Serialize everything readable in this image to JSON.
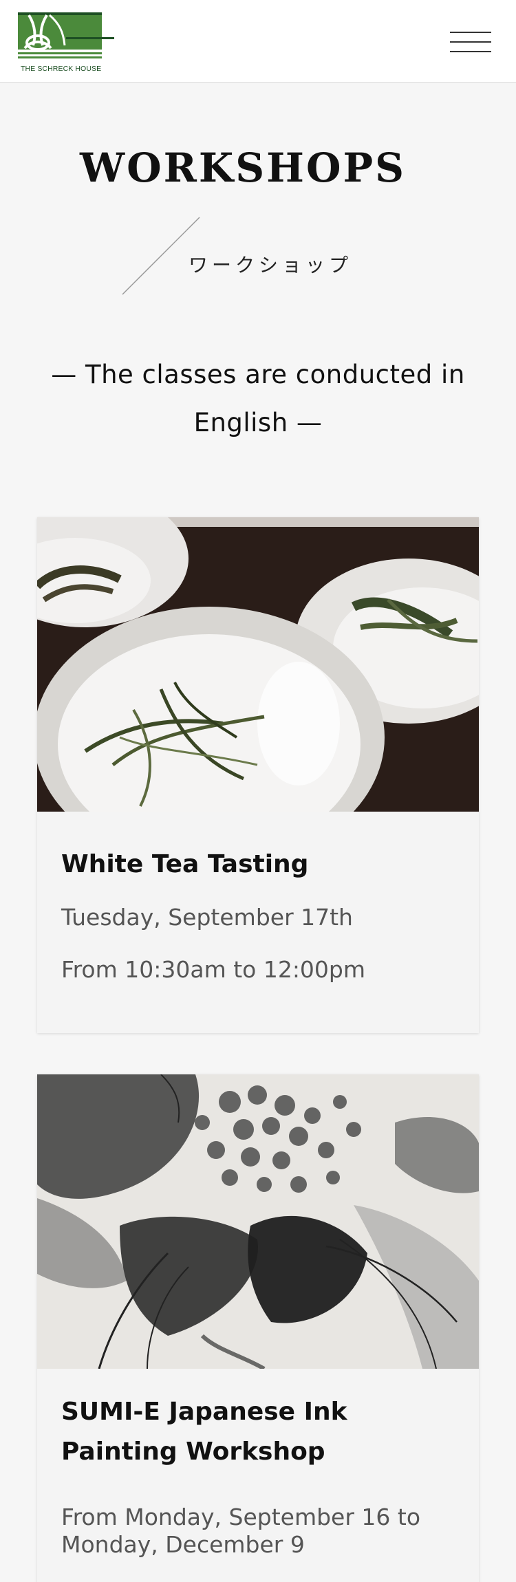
{
  "header": {
    "logo_text": "THE SCHRECK HOUSE",
    "menu_icon": "hamburger-menu-icon"
  },
  "page": {
    "title": "WORKSHOPS",
    "subtitle_jp": "ワークショップ",
    "note": "— The classes are conducted in English —"
  },
  "workshops": [
    {
      "title": "White Tea Tasting",
      "date": "Tuesday, September 17th",
      "time": "From 10:30am to 12:00pm",
      "image": "white-tea-leaves-on-plates"
    },
    {
      "title": "SUMI-E Japanese Ink Painting Workshop",
      "date": "From Monday, September 16 to Monday, December 9",
      "image": "sumi-e-ink-painting"
    }
  ],
  "colors": {
    "brand_green": "#4b8a3b",
    "dark_green": "#1d4f23",
    "background": "#f6f6f6"
  }
}
